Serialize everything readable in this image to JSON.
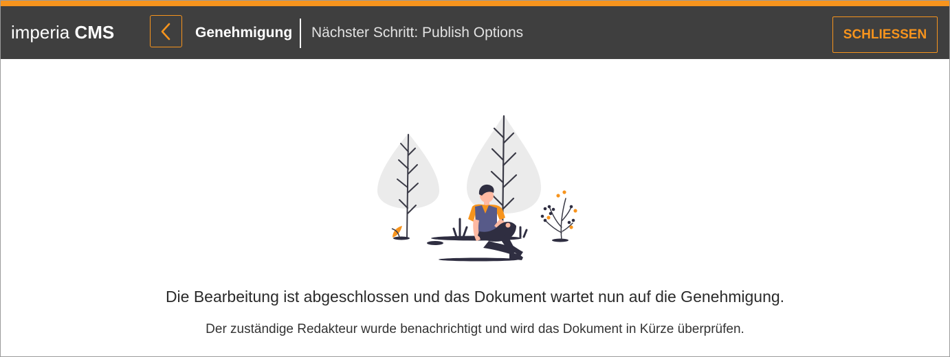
{
  "colors": {
    "accent": "#f7941d",
    "header_bg": "#3f3f3f"
  },
  "header": {
    "logo_light": "imperia",
    "logo_bold": "CMS",
    "back_icon": "chevron-left-icon",
    "title": "Genehmigung",
    "next_step": "Nächster Schritt: Publish Options",
    "close_label": "SCHLIESSEN"
  },
  "main": {
    "illustration": "person-sitting-under-trees",
    "headline": "Die Bearbeitung ist abgeschlossen und das Dokument wartet nun auf die Genehmigung.",
    "subline": "Der zuständige Redakteur wurde benachrichtigt und wird das Dokument in Kürze überprüfen."
  }
}
